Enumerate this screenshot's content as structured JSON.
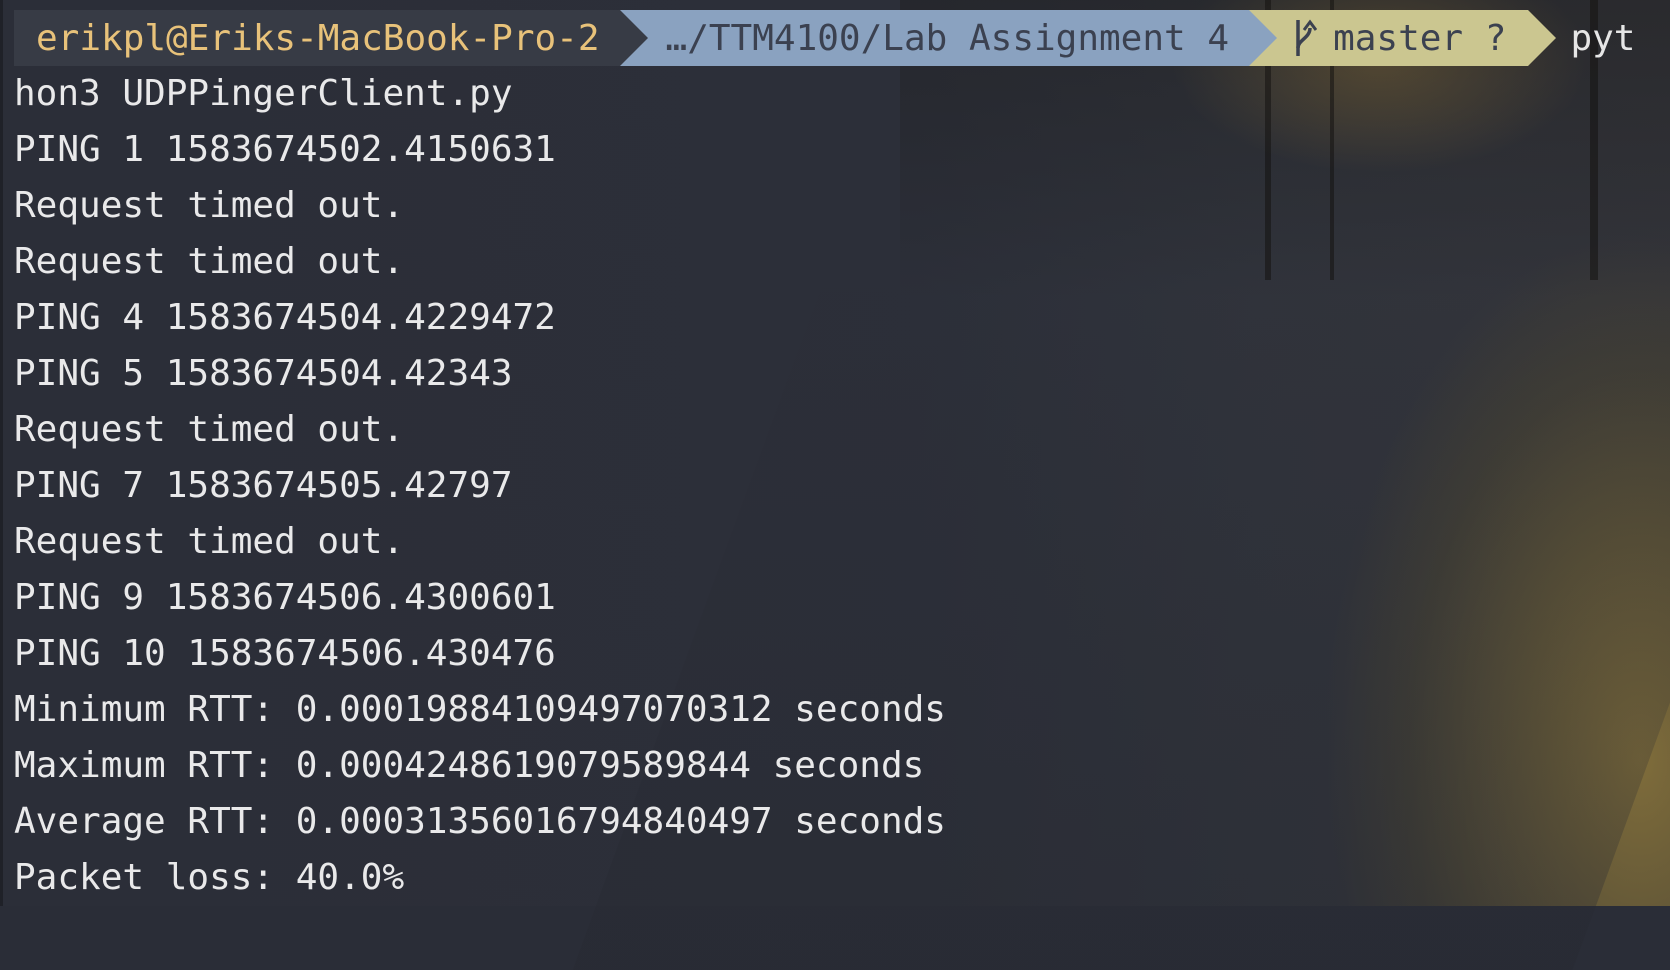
{
  "prompt": {
    "user_host": "erikpl@Eriks-MacBook-Pro-2",
    "directory": "…/TTM4100/Lab Assignment 4",
    "git_branch": "master ?",
    "git_icon": "git-branch-icon",
    "command_start": "pyt"
  },
  "output_lines": [
    "hon3 UDPPingerClient.py",
    "PING 1 1583674502.4150631",
    "Request timed out.",
    "Request timed out.",
    "PING 4 1583674504.4229472",
    "PING 5 1583674504.42343",
    "Request timed out.",
    "PING 7 1583674505.42797",
    "Request timed out.",
    "PING 9 1583674506.4300601",
    "PING 10 1583674506.430476",
    "Minimum RTT: 0.00019884109497070312 seconds",
    "Maximum RTT: 0.0004248619079589844 seconds",
    "Average RTT: 0.00031356016794840497 seconds",
    "Packet loss: 40.0%"
  ],
  "colors": {
    "background": "#2a2d37",
    "text": "#e9e9ea",
    "user_segment_bg": "#373b45",
    "user_segment_text": "#e8c27a",
    "dir_segment_bg": "#8aa2c0",
    "git_segment_bg": "#cbc690",
    "segment_text": "#3b4150"
  }
}
